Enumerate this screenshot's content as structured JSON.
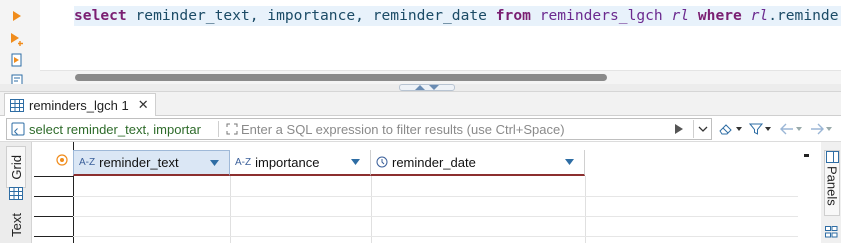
{
  "editor": {
    "sql": {
      "kw_select": "select",
      "columns": " reminder_text, importance, reminder_date ",
      "kw_from": "from",
      "space1": " ",
      "table": "reminders_lgch",
      "space2": " ",
      "alias": "rl",
      "space3": " ",
      "kw_where": "where",
      "space4": " ",
      "alias2": "rl",
      "tail": ".reminder_d"
    },
    "gutter_icons": [
      "execute-statement-icon",
      "execute-new-tab-icon",
      "execute-script-icon",
      "explain-plan-icon"
    ]
  },
  "result_tab": {
    "label": "reminders_lgch 1",
    "close": "✕"
  },
  "filter": {
    "query_label": "select reminder_text, importar",
    "placeholder": "Enter a SQL expression to filter results (use Ctrl+Space)",
    "value": ""
  },
  "grid": {
    "columns": [
      {
        "label": "reminder_text",
        "type_badge": "A-Z",
        "type": "text"
      },
      {
        "label": "importance",
        "type_badge": "A-Z",
        "type": "text"
      },
      {
        "label": "reminder_date",
        "type_badge": "",
        "type": "date"
      }
    ]
  },
  "side_tabs": {
    "grid": "Grid",
    "text": "Text",
    "panels": "Panels"
  },
  "colors": {
    "accent": "#2e6da4",
    "keyword": "#7a1f72",
    "column_underline": "#8c2f2f",
    "query_text": "#2e6b2a"
  }
}
